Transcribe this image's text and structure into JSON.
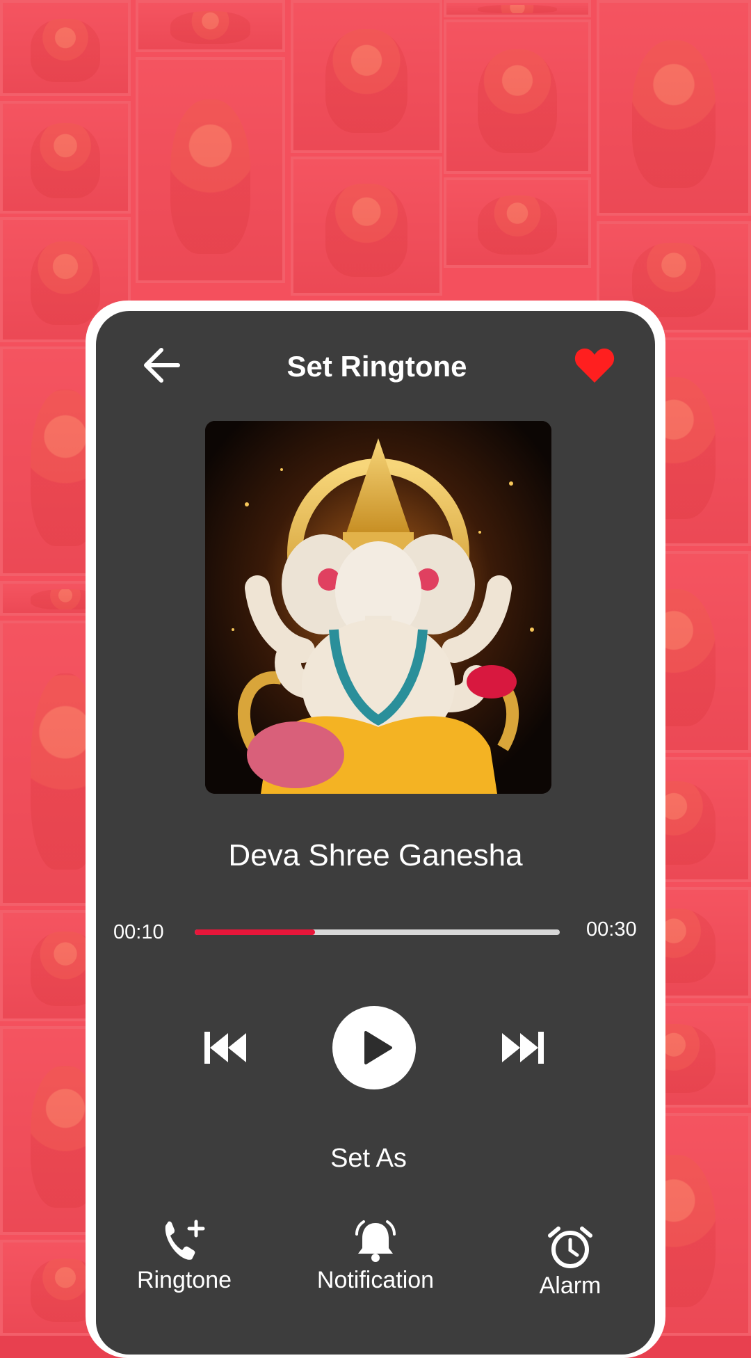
{
  "header": {
    "title": "Set Ringtone",
    "back_icon": "arrow-left-icon",
    "favorite_icon": "heart-icon",
    "favorite_color": "#ff1f1f"
  },
  "track": {
    "title": "Deva Shree Ganesha",
    "current_time": "00:10",
    "total_time": "00:30",
    "progress_fraction": 0.33
  },
  "controls": {
    "prev_icon": "skip-previous-icon",
    "play_icon": "play-icon",
    "next_icon": "skip-next-icon"
  },
  "set_as": {
    "heading": "Set As",
    "options": [
      {
        "label": "Ringtone",
        "icon": "phone-plus-icon"
      },
      {
        "label": "Notification",
        "icon": "bell-ringing-icon"
      },
      {
        "label": "Alarm",
        "icon": "alarm-clock-icon"
      }
    ]
  },
  "colors": {
    "accent": "#e8163a",
    "panel": "#3d3d3d",
    "background_tint": "#f25a66"
  }
}
